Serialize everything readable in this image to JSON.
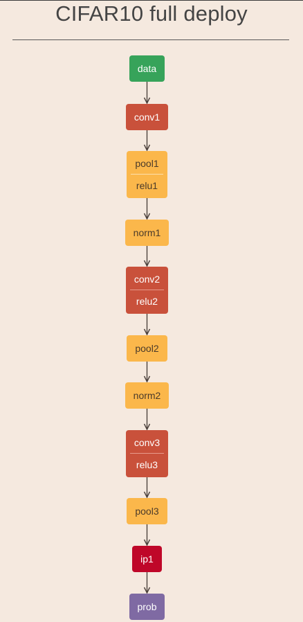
{
  "title": "CIFAR10 full deploy",
  "nodes": [
    {
      "id": "data",
      "labels": [
        "data"
      ],
      "kind": "input",
      "color": "#37a35a"
    },
    {
      "id": "conv1",
      "labels": [
        "conv1"
      ],
      "kind": "conv",
      "color": "#c9513b"
    },
    {
      "id": "pool1",
      "labels": [
        "pool1",
        "relu1"
      ],
      "kind": "pool",
      "color": "#fbb74b"
    },
    {
      "id": "norm1",
      "labels": [
        "norm1"
      ],
      "kind": "norm",
      "color": "#fbb74b"
    },
    {
      "id": "conv2",
      "labels": [
        "conv2",
        "relu2"
      ],
      "kind": "conv",
      "color": "#c9513b"
    },
    {
      "id": "pool2",
      "labels": [
        "pool2"
      ],
      "kind": "pool",
      "color": "#fbb74b"
    },
    {
      "id": "norm2",
      "labels": [
        "norm2"
      ],
      "kind": "norm",
      "color": "#fbb74b"
    },
    {
      "id": "conv3",
      "labels": [
        "conv3",
        "relu3"
      ],
      "kind": "conv",
      "color": "#c9513b"
    },
    {
      "id": "pool3",
      "labels": [
        "pool3"
      ],
      "kind": "pool",
      "color": "#fbb74b"
    },
    {
      "id": "ip1",
      "labels": [
        "ip1"
      ],
      "kind": "ip",
      "color": "#bf0729"
    },
    {
      "id": "prob",
      "labels": [
        "prob"
      ],
      "kind": "output",
      "color": "#7f6aa3"
    }
  ],
  "edges": [
    [
      "data",
      "conv1"
    ],
    [
      "conv1",
      "pool1"
    ],
    [
      "pool1",
      "norm1"
    ],
    [
      "norm1",
      "conv2"
    ],
    [
      "conv2",
      "pool2"
    ],
    [
      "pool2",
      "norm2"
    ],
    [
      "norm2",
      "conv3"
    ],
    [
      "conv3",
      "pool3"
    ],
    [
      "pool3",
      "ip1"
    ],
    [
      "ip1",
      "prob"
    ]
  ]
}
